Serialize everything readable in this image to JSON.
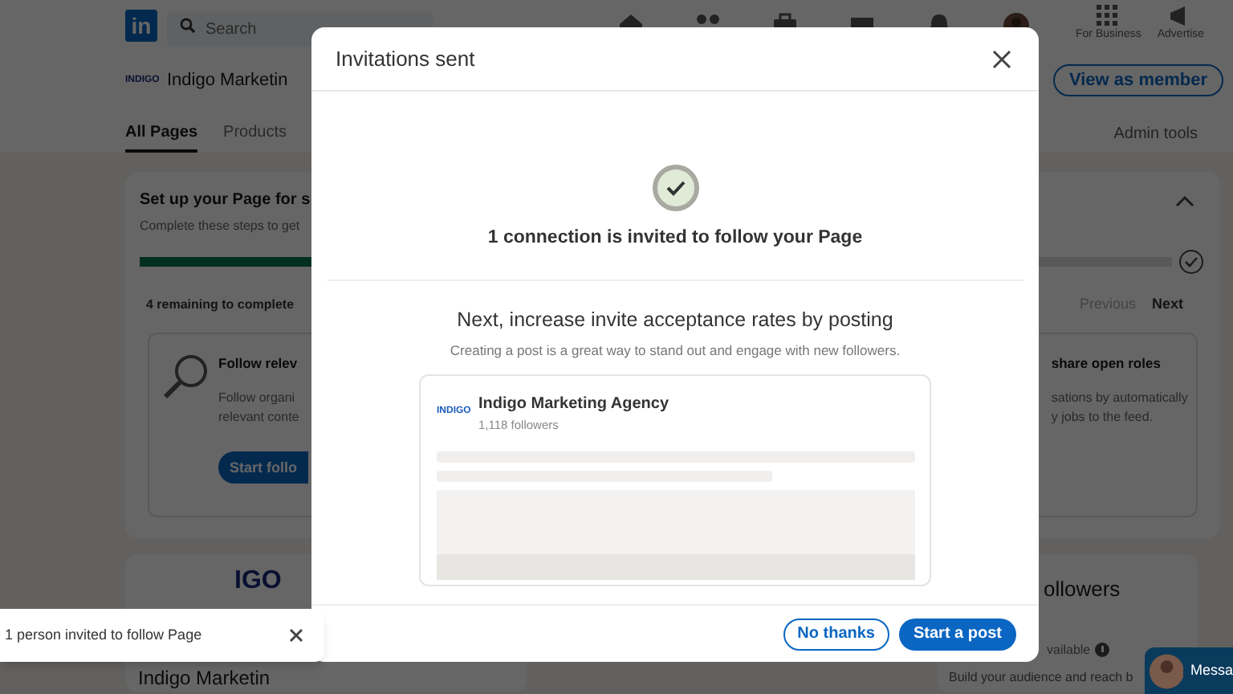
{
  "nav": {
    "logo": "in",
    "search_placeholder": "Search",
    "for_business": "For Business",
    "advertise": "Advertise"
  },
  "page_header": {
    "logo_text": "INDIGO",
    "name": "Indigo Marketin",
    "view_button": "View as member"
  },
  "page_tabs": [
    {
      "label": "All Pages",
      "selected": true
    },
    {
      "label": "Products",
      "selected": false
    }
  ],
  "admin_tools": "Admin tools",
  "setup_card": {
    "title": "Set up your Page for s",
    "subtitle": "Complete these steps to get",
    "level": 0.5,
    "remaining": "4 remaining to complete",
    "pager": [
      {
        "label": "Previous",
        "disabled": true
      },
      {
        "label": "Next",
        "disabled": false
      }
    ],
    "tasks": [
      {
        "title": "Follow relev",
        "lines": [
          "Follow organi",
          "relevant conte"
        ],
        "button": "Start follo"
      },
      {
        "title": "share open roles",
        "lines": [
          "sations by automatically",
          "y jobs to the feed."
        ]
      }
    ]
  },
  "second_row": {
    "logo_text": "IGO",
    "page_name": "Indigo Marketin",
    "followers_title": "ollowers",
    "availability": "vailable",
    "description": "Build your audience and reach b"
  },
  "messaging": {
    "label": "Messa"
  },
  "modal": {
    "title": "Invitations sent",
    "confirmation": "1 connection is invited to follow your Page",
    "heading": "Next, increase invite acceptance rates by posting",
    "subheading": "Creating a post is a great way to stand out and engage with new followers.",
    "preview": {
      "logo_text": "INDIGO",
      "name": "Indigo Marketing Agency",
      "followers": "1,118 followers"
    },
    "buttons": [
      {
        "label": "No thanks",
        "kind": "secondary"
      },
      {
        "label": "Start a post",
        "kind": "primary"
      }
    ]
  },
  "toast": {
    "message": "1 person invited to follow Page"
  }
}
